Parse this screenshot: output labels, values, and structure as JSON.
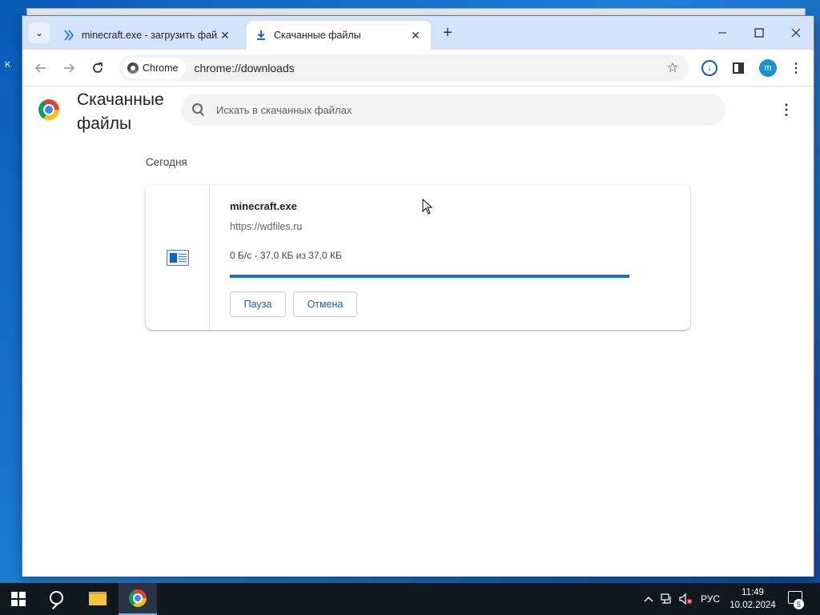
{
  "desktop": {
    "edge_text": "К"
  },
  "tabs": [
    {
      "title": "minecraft.exe - загрузить файл",
      "icon": "chevrons-icon",
      "active": false
    },
    {
      "title": "Скачанные файлы",
      "icon": "download-icon",
      "active": true
    }
  ],
  "toolbar": {
    "chip_label": "Chrome",
    "url": "chrome://downloads",
    "avatar_letter": "m"
  },
  "downloads_page": {
    "title": "Скачанные файлы",
    "search_placeholder": "Искать в скачанных файлах",
    "section_label": "Сегодня",
    "item": {
      "file_name": "minecraft.exe",
      "source_url": "https://wdfiles.ru",
      "status": "0 Б/с - 37,0 КБ из 37,0 КБ",
      "progress_percent": 100,
      "pause_label": "Пауза",
      "cancel_label": "Отмена"
    }
  },
  "taskbar": {
    "language": "РУС",
    "time": "11:49",
    "date": "10.02.2024",
    "notification_count": "5"
  },
  "colors": {
    "accent": "#0b57d0",
    "progress": "#1a73c7",
    "tabstrip": "#d3e3fd",
    "taskbar": "#101820"
  }
}
